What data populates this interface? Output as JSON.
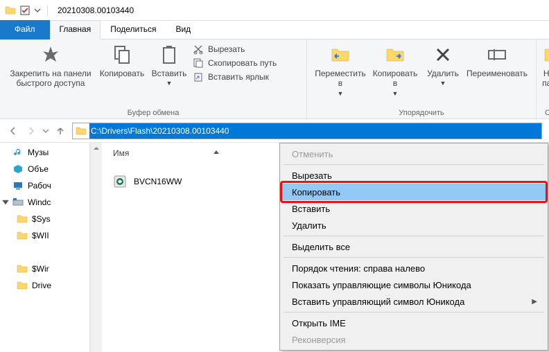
{
  "titlebar": {
    "window_title": "20210308.00103440"
  },
  "tabs": {
    "file": "Файл",
    "home": "Главная",
    "share": "Поделиться",
    "view": "Вид"
  },
  "ribbon": {
    "pin": {
      "line1": "Закрепить на панели",
      "line2": "быстрого доступа"
    },
    "copy": "Копировать",
    "paste": "Вставить",
    "cut": "Вырезать",
    "copy_path": "Скопировать путь",
    "paste_shortcut": "Вставить ярлык",
    "clipboard_caption": "Буфер обмена",
    "move_to": {
      "line1": "Переместить",
      "line2": "в"
    },
    "copy_to": {
      "line1": "Копировать",
      "line2": "в"
    },
    "delete": "Удалить",
    "rename": "Переименовать",
    "organize_caption": "Упорядочить",
    "new_folder": {
      "line1": "Нова",
      "line2": "папка"
    },
    "new_caption": "Соз"
  },
  "address_path": "C:\\Drivers\\Flash\\20210308.00103440",
  "columns": {
    "name": "Имя"
  },
  "files": [
    {
      "name": "BVCN16WW"
    }
  ],
  "sidebar": {
    "music": "Музы",
    "objects": "Объе",
    "desktop": "Рабоч",
    "windows": "Windc",
    "sys": "$Sys",
    "winbt": "$WII",
    "winre": "$Wir",
    "drive": "Drive"
  },
  "context_menu": {
    "undo": "Отменить",
    "cut": "Вырезать",
    "copy": "Копировать",
    "paste": "Вставить",
    "delete": "Удалить",
    "select_all": "Выделить все",
    "reading_order": "Порядок чтения: справа налево",
    "show_unicode": "Показать управляющие символы Юникода",
    "insert_unicode": "Вставить управляющий символ Юникода",
    "open_ime": "Открыть IME",
    "reconversion": "Реконверсия"
  }
}
